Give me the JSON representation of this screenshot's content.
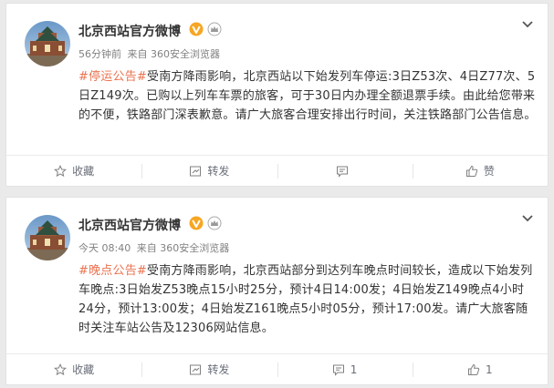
{
  "posts": [
    {
      "username": "北京西站官方微博",
      "time": "56分钟前",
      "source": "来自 360安全浏览器",
      "tag": "#停运公告#",
      "body": "受南方降雨影响，北京西站以下始发列车停运:3日Z53次、4日Z77次、5日Z149次。已购以上列车车票的旅客，可于30日内办理全额退票手续。由此给您带来的不便，铁路部门深表歉意。请广大旅客合理安排出行时间，关注铁路部门公告信息。",
      "actions": {
        "favorite": "收藏",
        "repost": "转发",
        "comment": "",
        "like": "赞"
      }
    },
    {
      "username": "北京西站官方微博",
      "time": "今天 08:40",
      "source": "来自 360安全浏览器",
      "tag": "#晚点公告#",
      "body": "受南方降雨影响，北京西站部分到达列车晚点时间较长，造成以下始发列车晚点:3日始发Z53晚点15小时25分，预计4日14:00发；4日始发Z149晚点4小时24分，预计13:00发；4日始发Z161晚点5小时05分，预计17:00发。请广大旅客随时关注车站公告及12306网站信息。",
      "actions": {
        "favorite": "收藏",
        "repost": "转发",
        "comment": "1",
        "like": "1"
      }
    }
  ],
  "colors": {
    "tag": "#eb7350",
    "meta": "#808080",
    "toolbar_text": "#696e78",
    "background": "#eaeaea"
  },
  "icons": [
    "avatar",
    "verified-v-icon",
    "vip-crown-icon",
    "chevron-down-icon",
    "star-icon",
    "repost-icon",
    "comment-icon",
    "thumbs-up-icon"
  ]
}
